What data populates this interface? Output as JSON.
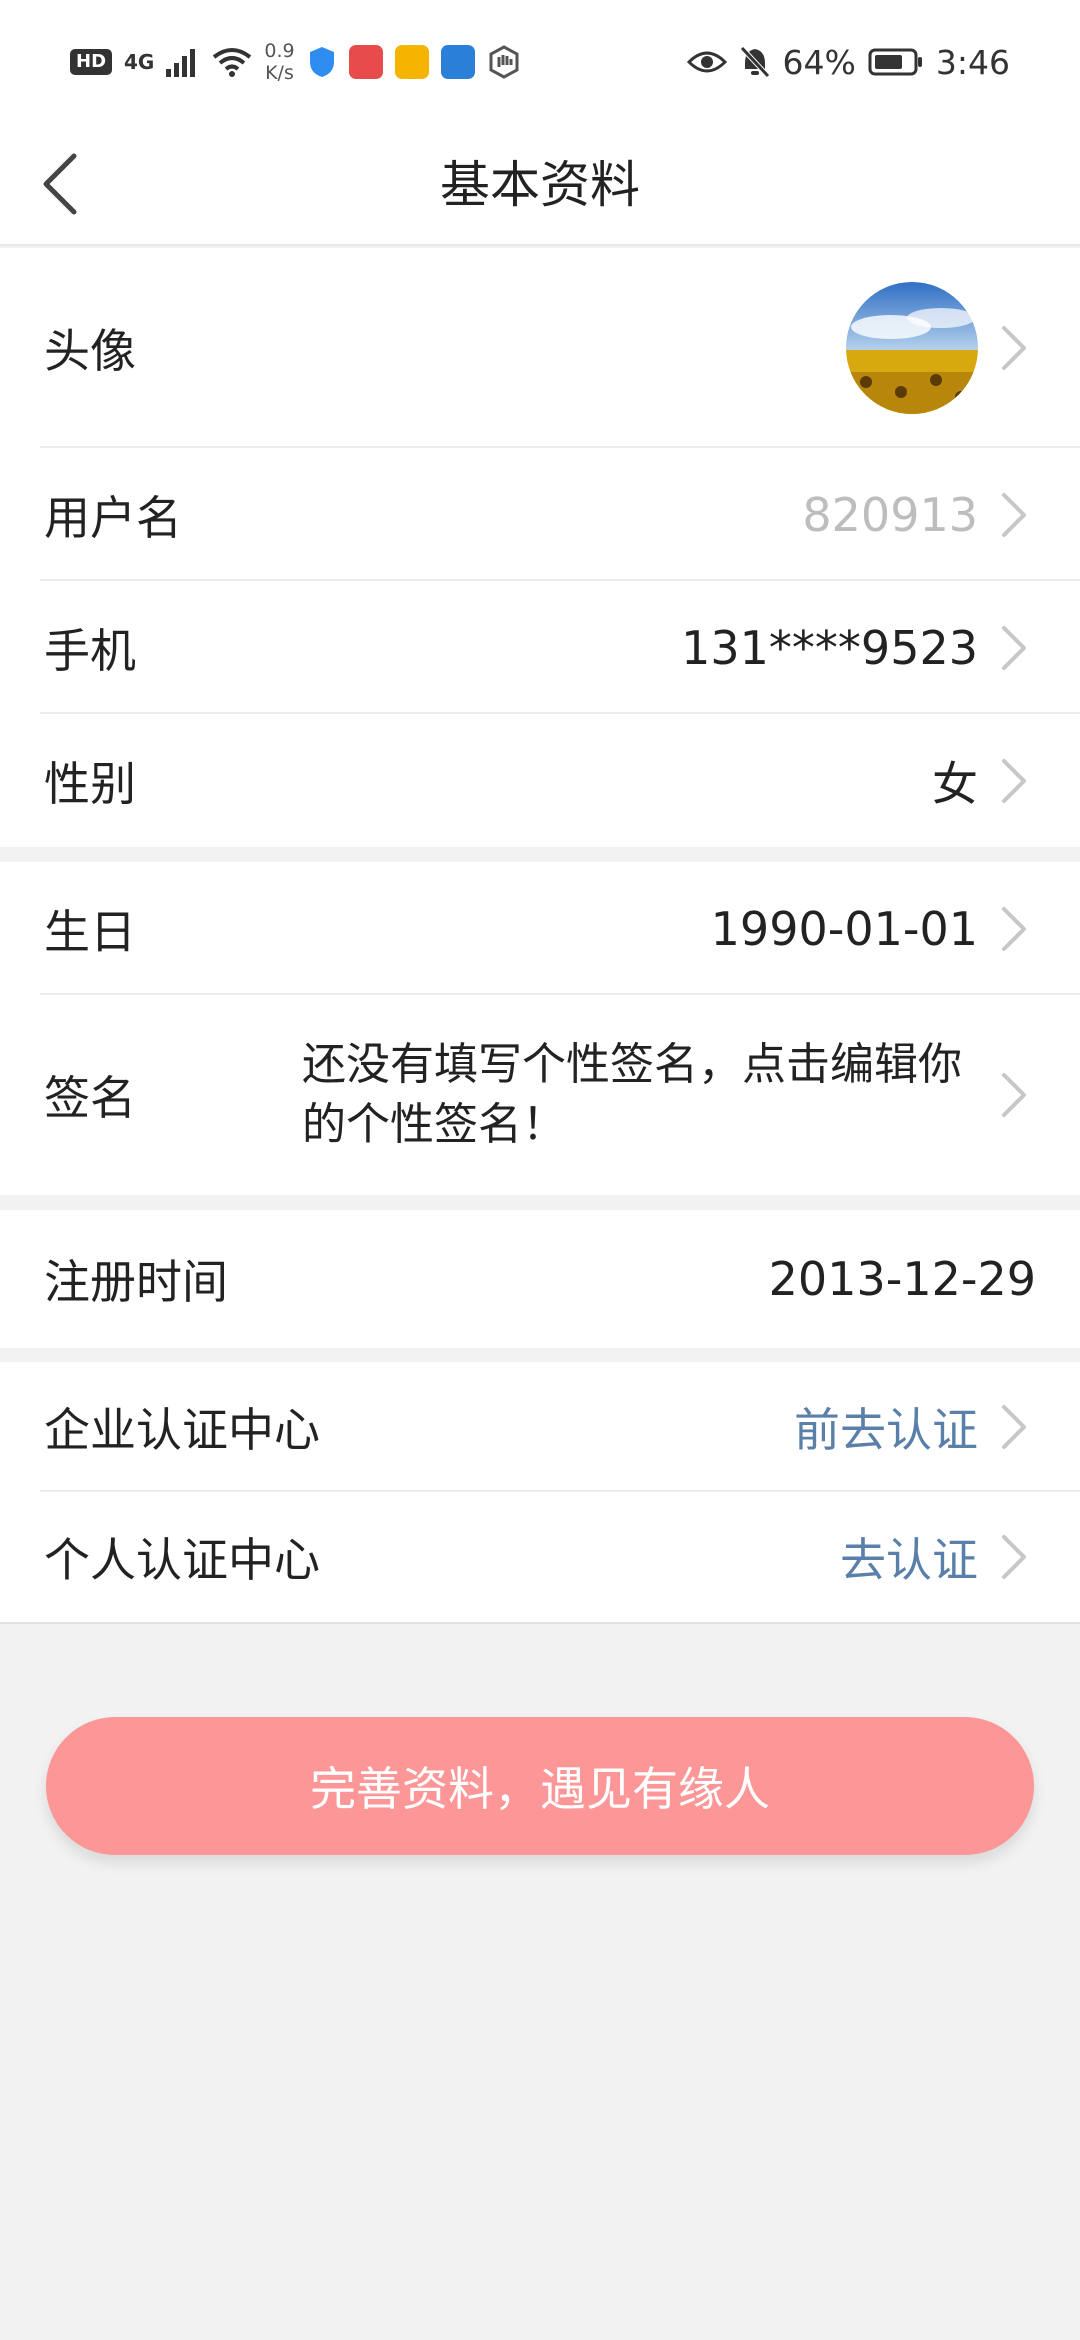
{
  "status_bar": {
    "hd": "HD",
    "net_type": "4G",
    "speed_value": "0.9",
    "speed_unit": "K/s",
    "battery_pct": "64%",
    "time": "3:46"
  },
  "header": {
    "title": "基本资料"
  },
  "profile": {
    "avatar_label": "头像",
    "username_label": "用户名",
    "username_value": "820913",
    "phone_label": "手机",
    "phone_value": "131****9523",
    "gender_label": "性别",
    "gender_value": "女",
    "birthday_label": "生日",
    "birthday_value": "1990-01-01",
    "signature_label": "签名",
    "signature_value": "还没有填写个性签名，点击编辑你的个性签名！",
    "register_label": "注册时间",
    "register_value": "2013-12-29",
    "enterprise_label": "企业认证中心",
    "enterprise_value": "前去认证",
    "personal_label": "个人认证中心",
    "personal_value": "去认证"
  },
  "cta_label": "完善资料，遇见有缘人",
  "colors": {
    "accent_link": "#5a7fa8",
    "cta_bg": "#fd9696",
    "page_bg": "#f2f2f2"
  }
}
